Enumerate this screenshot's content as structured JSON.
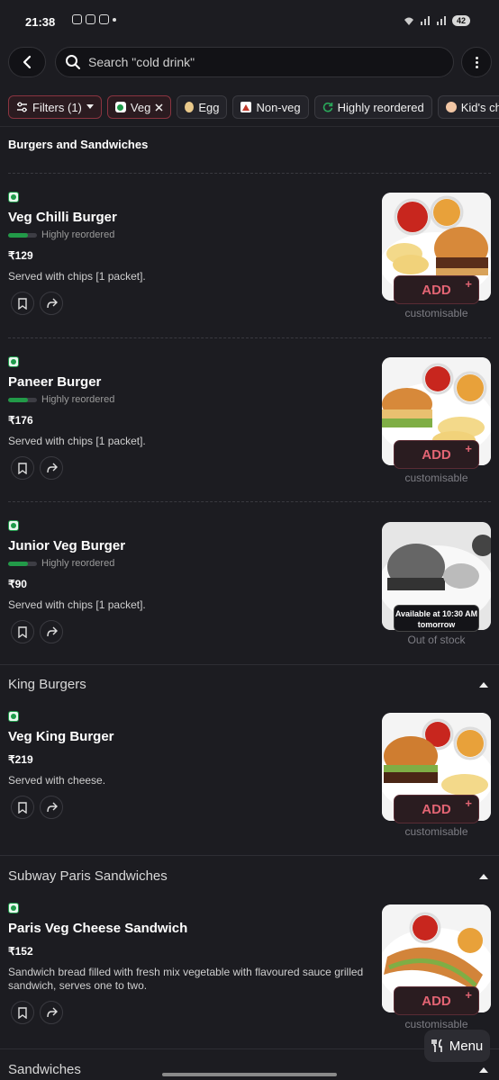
{
  "status": {
    "time": "21:38",
    "battery": "42"
  },
  "search": {
    "placeholder": "Search \"cold drink\""
  },
  "filters": [
    {
      "label": "Filters (1)"
    },
    {
      "label": "Veg"
    },
    {
      "label": "Egg"
    },
    {
      "label": "Non-veg"
    },
    {
      "label": "Highly reordered"
    },
    {
      "label": "Kid's ch"
    }
  ],
  "sections": [
    {
      "title": "Burgers and Sandwiches"
    },
    {
      "title": "King Burgers"
    },
    {
      "title": "Subway Paris Sandwiches"
    },
    {
      "title": "Sandwiches"
    }
  ],
  "items": [
    {
      "name": "Veg Chilli Burger",
      "reorder": "Highly reordered",
      "price": "₹129",
      "desc": "Served with chips [1 packet].",
      "add": "ADD",
      "note": "customisable",
      "reorder_level": 0.7
    },
    {
      "name": "Paneer Burger",
      "reorder": "Highly reordered",
      "price": "₹176",
      "desc": "Served with chips [1 packet].",
      "add": "ADD",
      "note": "customisable",
      "reorder_level": 0.7
    },
    {
      "name": "Junior Veg Burger",
      "reorder": "Highly reordered",
      "price": "₹90",
      "desc": "Served with chips [1 packet].",
      "availability": "Available at 10:30 AM tomorrow",
      "note": "Out of stock",
      "reorder_level": 0.7
    },
    {
      "name": "Veg King Burger",
      "price": "₹219",
      "desc": "Served with cheese.",
      "add": "ADD",
      "note": "customisable"
    },
    {
      "name": "Paris Veg Cheese Sandwich",
      "price": "₹152",
      "desc": "Sandwich bread filled with fresh mix vegetable with flavoured sauce grilled sandwich, serves one to two.",
      "add": "ADD",
      "note": "customisable"
    }
  ],
  "menu_button": {
    "label": "Menu"
  },
  "colors": {
    "background": "#1c1c21",
    "veg": "#1e9a4a",
    "accent": "#e26473"
  }
}
